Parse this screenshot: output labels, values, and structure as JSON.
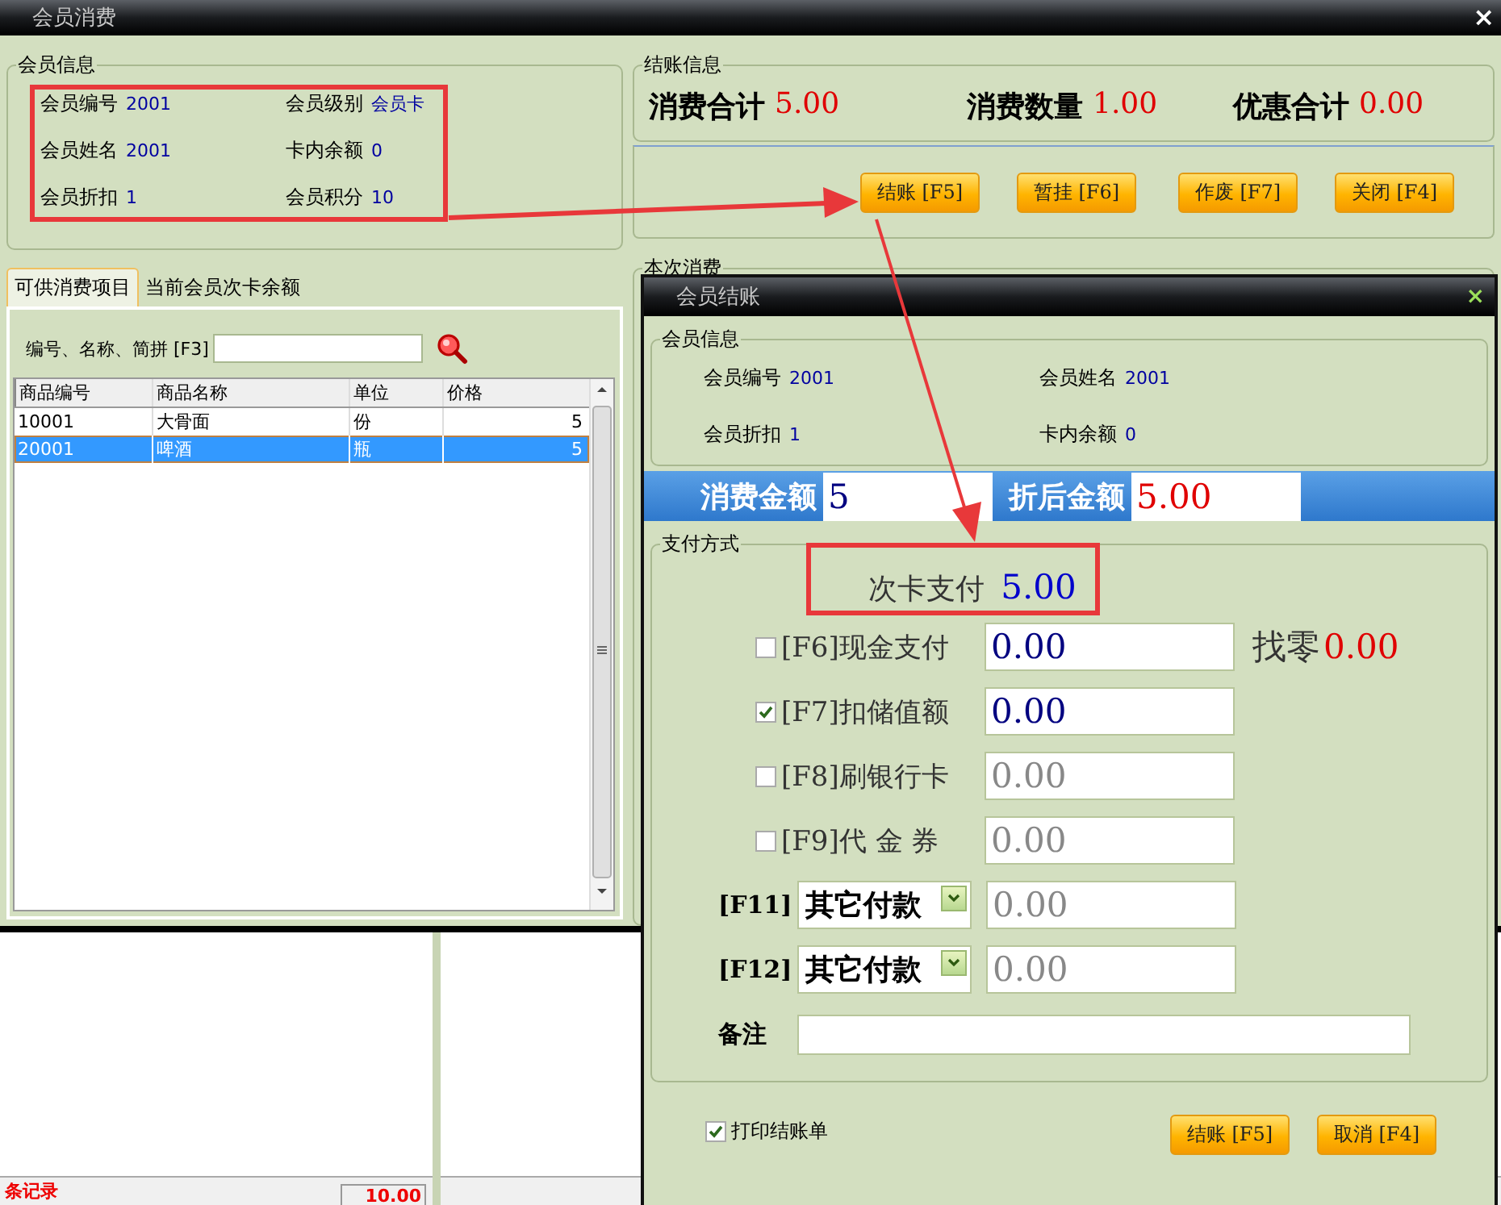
{
  "window": {
    "title": "会员消费",
    "close": "×"
  },
  "member_info": {
    "title": "会员信息",
    "fields": [
      {
        "label": "会员编号",
        "value": "2001"
      },
      {
        "label": "会员级别",
        "value": "会员卡"
      },
      {
        "label": "会员姓名",
        "value": "2001"
      },
      {
        "label": "卡内余额",
        "value": "0"
      },
      {
        "label": "会员折扣",
        "value": "1"
      },
      {
        "label": "会员积分",
        "value": "10"
      }
    ]
  },
  "tabs": [
    {
      "label": "可供消费项目",
      "selected": true
    },
    {
      "label": "当前会员次卡余额",
      "selected": false
    }
  ],
  "search": {
    "label": "编号、名称、简拼 [F3]"
  },
  "table": {
    "columns": [
      "商品编号",
      "商品名称",
      "单位",
      "价格"
    ],
    "rows": [
      {
        "cells": [
          "10001",
          "大骨面",
          "份",
          "5"
        ],
        "selected": false
      },
      {
        "cells": [
          "20001",
          "啤酒",
          "瓶",
          "5"
        ],
        "selected": true
      }
    ]
  },
  "status_bar": {
    "record_count": "条记录",
    "total": "10.00"
  },
  "checkout_info": {
    "title": "结账信息",
    "totals": [
      {
        "label": "消费合计",
        "value": "5.00"
      },
      {
        "label": "消费数量",
        "value": "1.00"
      },
      {
        "label": "优惠合计",
        "value": "0.00"
      }
    ]
  },
  "buttons": [
    "结账 [F5]",
    "暂挂 [F6]",
    "作废 [F7]",
    "关闭 [F4]"
  ],
  "current_consumption": {
    "title": "本次消费"
  },
  "dialog": {
    "title": "会员结账",
    "close": "×",
    "member_info": {
      "title": "会员信息",
      "fields": [
        {
          "label": "会员编号",
          "value": "2001"
        },
        {
          "label": "会员姓名",
          "value": "2001"
        },
        {
          "label": "会员折扣",
          "value": "1"
        },
        {
          "label": "卡内余额",
          "value": "0"
        }
      ]
    },
    "amounts": [
      {
        "label": "消费金额",
        "value": "5"
      },
      {
        "label": "折后金额",
        "value": "5.00"
      }
    ],
    "payment": {
      "title": "支付方式",
      "card_payment": {
        "label": "次卡支付",
        "value": "5.00"
      },
      "methods": [
        {
          "kind": "checkbox",
          "label": "[F6]现金支付",
          "checked": false,
          "disabled": false,
          "value": "0.00"
        },
        {
          "kind": "checkbox",
          "label": "[F7]扣储值额",
          "checked": true,
          "disabled": false,
          "value": "0.00"
        },
        {
          "kind": "checkbox",
          "label": "[F8]刷银行卡",
          "checked": false,
          "disabled": true,
          "value": "0.00"
        },
        {
          "kind": "checkbox",
          "label": "[F9]代 金 券",
          "checked": false,
          "disabled": true,
          "value": "0.00"
        },
        {
          "kind": "select",
          "label": "[F11]",
          "option": "其它付款",
          "disabled": true,
          "value": "0.00"
        },
        {
          "kind": "select",
          "label": "[F12]",
          "option": "其它付款",
          "disabled": true,
          "value": "0.00"
        }
      ],
      "change": {
        "label": "找零",
        "value": "0.00"
      },
      "remark": {
        "label": "备注"
      }
    },
    "print_receipt": {
      "label": "打印结账单",
      "checked": true
    },
    "buttons": [
      "结账 [F5]",
      "取消 [F4]"
    ]
  }
}
